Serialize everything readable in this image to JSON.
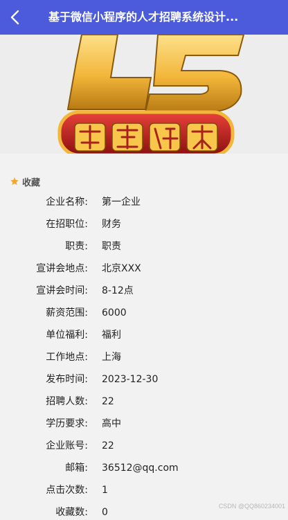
{
  "header": {
    "title": "基于微信小程序的人才招聘系统设计..."
  },
  "favorite": {
    "label": "收藏",
    "icon": "star-icon",
    "color": "#f0a830"
  },
  "details": [
    {
      "label": "企业名称:",
      "value": "第一企业"
    },
    {
      "label": "在招职位:",
      "value": "财务"
    },
    {
      "label": "职责:",
      "value": "职责"
    },
    {
      "label": "宣讲会地点:",
      "value": "北京XXX"
    },
    {
      "label": "宣讲会时间:",
      "value": "8-12点"
    },
    {
      "label": "薪资范围:",
      "value": "6000"
    },
    {
      "label": "单位福利:",
      "value": "福利"
    },
    {
      "label": "工作地点:",
      "value": "上海"
    },
    {
      "label": "发布时间:",
      "value": "2023-12-30"
    },
    {
      "label": "招聘人数:",
      "value": "22"
    },
    {
      "label": "学历要求:",
      "value": "高中"
    },
    {
      "label": "企业账号:",
      "value": "22"
    },
    {
      "label": "邮箱:",
      "value": "36512@qq.com"
    },
    {
      "label": "点击次数:",
      "value": "1"
    },
    {
      "label": "收藏数:",
      "value": "0"
    }
  ],
  "watermark": "CSDN @QQ860234001",
  "colors": {
    "header": "#4b5bdb",
    "banner_gold": "#f2b63a",
    "banner_red": "#c8201f"
  }
}
